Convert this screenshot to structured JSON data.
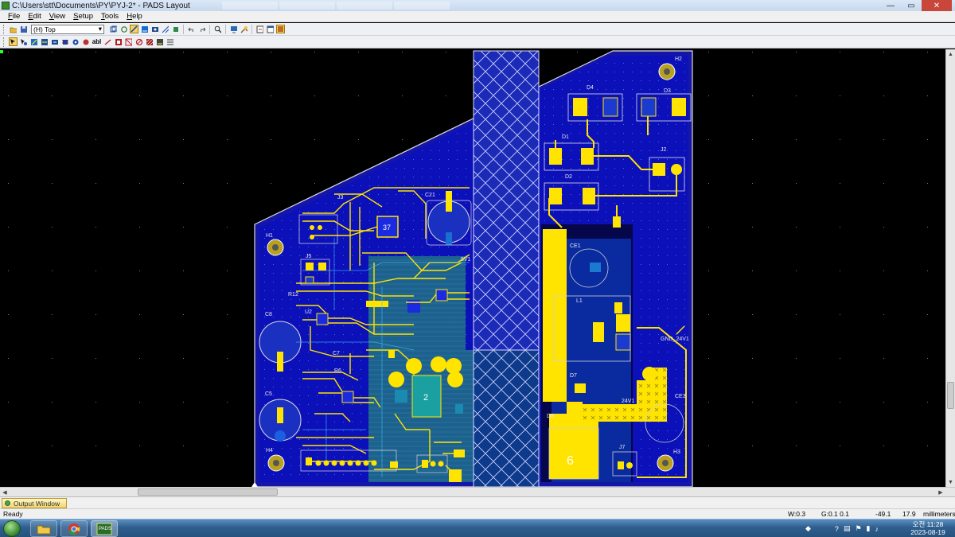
{
  "window": {
    "title": "C:\\Users\\stt\\Documents\\PY\\PYJ-2* - PADS Layout",
    "buttons": {
      "minimize": "—",
      "maximize": "▭",
      "close": "✕"
    }
  },
  "menu": [
    "File",
    "Edit",
    "View",
    "Setup",
    "Tools",
    "Help"
  ],
  "toolbar": {
    "layer_value": "(H) Top",
    "icons_row1": [
      "open-icon",
      "save-icon",
      "layer-pair-icon",
      "redraw-icon",
      "design-toolbar-icon",
      "drafting-icon",
      "ecos-icon",
      "bga-icon",
      "router-icon",
      "undo-icon",
      "redo-icon",
      "zoom-icon",
      "query-icon",
      "properties-icon",
      "save-view-icon",
      "window-icon"
    ],
    "icons_row2": [
      "select-icon",
      "move-icon",
      "add-trace-icon",
      "route-icon",
      "dimension-icon",
      "component-icon",
      "via-icon",
      "copper-icon",
      "text-icon",
      "2d-line-icon",
      "pour-icon",
      "cutout-icon",
      "keepout-icon",
      "hatch-icon",
      "flood-icon",
      "dxp-icon"
    ]
  },
  "board": {
    "labels": [
      {
        "name": "ref-h2",
        "text": "H2"
      },
      {
        "name": "ref-d4",
        "text": "D4"
      },
      {
        "name": "ref-d3",
        "text": "D3"
      },
      {
        "name": "ref-d1",
        "text": "D1"
      },
      {
        "name": "ref-j2",
        "text": "J2"
      },
      {
        "name": "ref-d2",
        "text": "D2"
      },
      {
        "name": "ref-j3",
        "text": "J3"
      },
      {
        "name": "ref-c21",
        "text": "C21"
      },
      {
        "name": "ref-h1",
        "text": "H1"
      },
      {
        "name": "ref-j5",
        "text": "J5"
      },
      {
        "name": "ref-5v1",
        "text": "5V1"
      },
      {
        "name": "ref-r12",
        "text": "R12"
      },
      {
        "name": "ref-c8",
        "text": "C8"
      },
      {
        "name": "ref-u2",
        "text": "U2"
      },
      {
        "name": "ref-c7",
        "text": "C7"
      },
      {
        "name": "ref-r6",
        "text": "R6"
      },
      {
        "name": "ref-c5",
        "text": "C5"
      },
      {
        "name": "ref-h4",
        "text": "H4"
      },
      {
        "name": "ref-ce1",
        "text": "CE1"
      },
      {
        "name": "ref-l1",
        "text": "L1"
      },
      {
        "name": "ref-gnd-24v1",
        "text": "GND_24V1"
      },
      {
        "name": "ref-d7",
        "text": "D7"
      },
      {
        "name": "ref-d8",
        "text": "D8"
      },
      {
        "name": "ref-24v1",
        "text": "24V1"
      },
      {
        "name": "ref-ce3",
        "text": "CE3"
      },
      {
        "name": "ref-j7",
        "text": "J7"
      },
      {
        "name": "ref-h3",
        "text": "H3"
      },
      {
        "name": "chip-37",
        "text": "37"
      },
      {
        "name": "chip-2",
        "text": "2"
      },
      {
        "name": "chip-6",
        "text": "6"
      }
    ]
  },
  "output_window": {
    "label": "Output Window"
  },
  "status": {
    "ready": "Ready",
    "width": "W:0.3",
    "grid": "G:0.1 0.1",
    "x": "-49.1",
    "y": "17.9",
    "units": "millimeters"
  },
  "taskbar": {
    "apps": [
      "explorer-icon",
      "chrome-icon",
      "pads-icon"
    ],
    "pads_label": "PADS",
    "time": "오전 11:28",
    "date": "2023-08-19"
  }
}
